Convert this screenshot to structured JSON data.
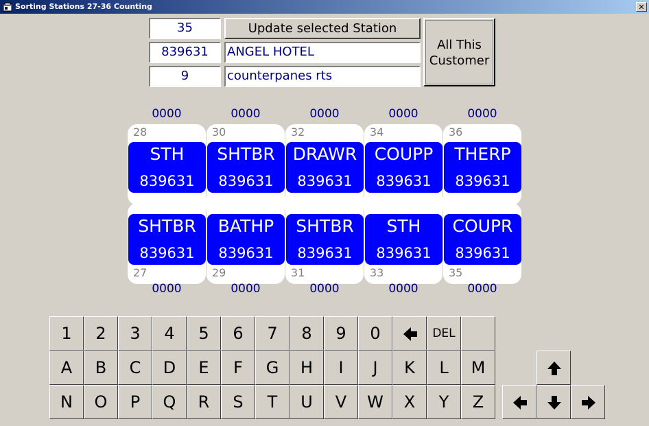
{
  "window": {
    "title": "Sorting Stations 27-36 Counting"
  },
  "form": {
    "station": "35",
    "customer_id": "839631",
    "customer_name": "ANGEL HOTEL",
    "product_id": "9",
    "product_name": "counterpanes rts",
    "update_button": "Update selected Station",
    "all_customer_button_line1": "All This",
    "all_customer_button_line2": "Customer"
  },
  "stations": {
    "top": [
      {
        "count": "0000",
        "number": "28",
        "code": "STH",
        "customer": "839631"
      },
      {
        "count": "0000",
        "number": "30",
        "code": "SHTBR",
        "customer": "839631"
      },
      {
        "count": "0000",
        "number": "32",
        "code": "DRAWR",
        "customer": "839631"
      },
      {
        "count": "0000",
        "number": "34",
        "code": "COUPP",
        "customer": "839631"
      },
      {
        "count": "0000",
        "number": "36",
        "code": "THERP",
        "customer": "839631"
      }
    ],
    "bottom": [
      {
        "count": "0000",
        "number": "27",
        "code": "SHTBR",
        "customer": "839631"
      },
      {
        "count": "0000",
        "number": "29",
        "code": "BATHP",
        "customer": "839631"
      },
      {
        "count": "0000",
        "number": "31",
        "code": "SHTBR",
        "customer": "839631"
      },
      {
        "count": "0000",
        "number": "33",
        "code": "STH",
        "customer": "839631"
      },
      {
        "count": "0000",
        "number": "35",
        "code": "COUPR",
        "customer": "839631"
      }
    ]
  },
  "keyboard": {
    "row1": [
      "1",
      "2",
      "3",
      "4",
      "5",
      "6",
      "7",
      "8",
      "9",
      "0"
    ],
    "del_label": "DEL",
    "row2": [
      "A",
      "B",
      "C",
      "D",
      "E",
      "F",
      "G",
      "H",
      "I",
      "J",
      "K",
      "L",
      "M"
    ],
    "row3": [
      "N",
      "O",
      "P",
      "Q",
      "R",
      "S",
      "T",
      "U",
      "V",
      "W",
      "X",
      "Y",
      "Z"
    ]
  },
  "colors": {
    "tile": "#0000ff",
    "count_text": "#00007f",
    "background": "#d4d0c8"
  }
}
